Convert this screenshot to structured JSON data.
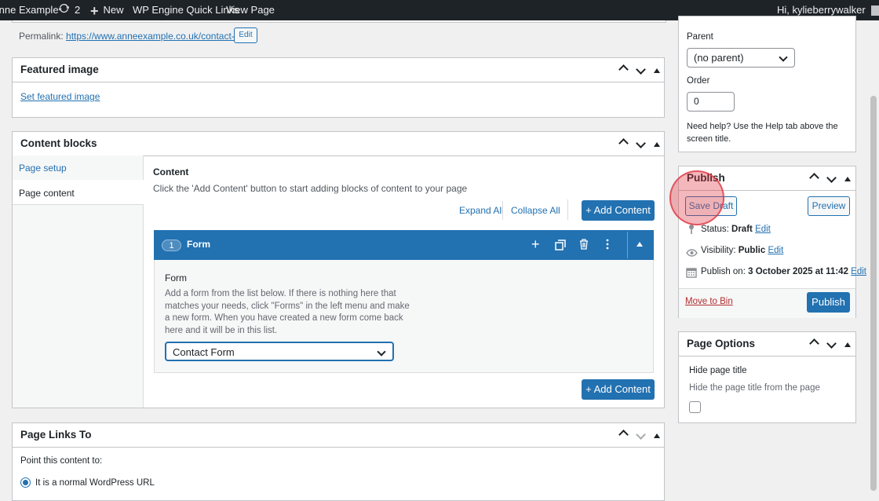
{
  "adminbar": {
    "site_name": "Anne Example",
    "updates_count": "2",
    "new_label": "New",
    "quick_links_label": "WP Engine Quick Links",
    "view_page_label": "View Page",
    "greeting": "Hi, kylieberrywalker"
  },
  "permalink": {
    "label": "Permalink:",
    "url": "https://www.anneexample.co.uk/contact-form/",
    "edit_label": "Edit"
  },
  "featured_image": {
    "title": "Featured image",
    "link_label": "Set featured image"
  },
  "content_blocks": {
    "title": "Content blocks",
    "tabs": [
      {
        "label": "Page setup"
      },
      {
        "label": "Page content"
      }
    ],
    "content_label": "Content",
    "content_help": "Click the 'Add Content' button to start adding blocks of content to your page",
    "expand_all": "Expand All",
    "collapse_all": "Collapse All",
    "add_content_label": "+ Add Content",
    "block": {
      "number": "1",
      "name": "Form",
      "field_label": "Form",
      "help_line1": "Add a form from the list below. If there is nothing here that",
      "help_line2": "matches your needs, click \"Forms\" in the left menu and make",
      "help_line3": "a new form. When you have created a new form come back",
      "help_line4": "here and it will be in this list.",
      "selected_form": "Contact Form"
    }
  },
  "page_links": {
    "title": "Page Links To",
    "point_label": "Point this content to:",
    "option_label": "It is a normal WordPress URL"
  },
  "page_attributes": {
    "parent_label": "Parent",
    "parent_value": "(no parent)",
    "order_label": "Order",
    "order_value": "0",
    "help_line1": "Need help? Use the Help tab above the",
    "help_line2": "screen title."
  },
  "publish": {
    "title": "Publish",
    "save_draft": "Save Draft",
    "preview": "Preview",
    "status_label": "Status:",
    "status_value": "Draft",
    "visibility_label": "Visibility:",
    "visibility_value": "Public",
    "publish_on_label": "Publish on:",
    "publish_on_value": "3 October 2025 at 11:42",
    "edit_label": "Edit",
    "move_to_bin": "Move to Bin",
    "publish_button": "Publish"
  },
  "page_options": {
    "title": "Page Options",
    "hide_title_label": "Hide page title",
    "hide_title_help": "Hide the page title from the page"
  },
  "colors": {
    "accent": "#2271b1",
    "adminbar": "#1d2327",
    "click_highlight": "#e0323c"
  }
}
